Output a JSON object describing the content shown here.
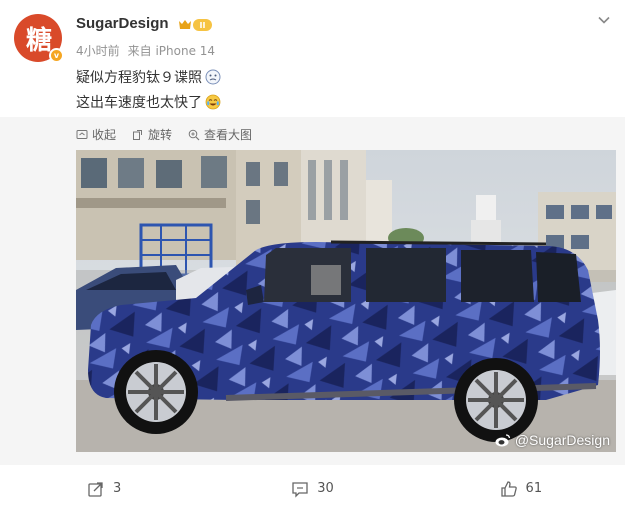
{
  "post": {
    "username": "SugarDesign",
    "avatar_text": "糖",
    "member_level": "II",
    "time": "4小时前",
    "source": "来自 iPhone 14",
    "line1": "疑似方程豹钛９谍照",
    "line2": "这出车速度也太快了",
    "tools": {
      "collect": "收起",
      "rotate": "旋转",
      "view_large": "查看大图"
    },
    "watermark": "@SugarDesign",
    "actions": {
      "share_count": "3",
      "comment_count": "30",
      "like_count": "61"
    }
  },
  "colors": {
    "avatar": "#d94a2a",
    "badge": "#f5a623",
    "camo_dark": "#1e2a6e",
    "camo_light": "#5b6fc4",
    "sky": "#d8dde2"
  },
  "icons": [
    "chevron-down-icon",
    "collect-icon",
    "rotate-icon",
    "view-large-icon",
    "weibo-logo-icon",
    "share-icon",
    "comment-icon",
    "like-icon"
  ]
}
